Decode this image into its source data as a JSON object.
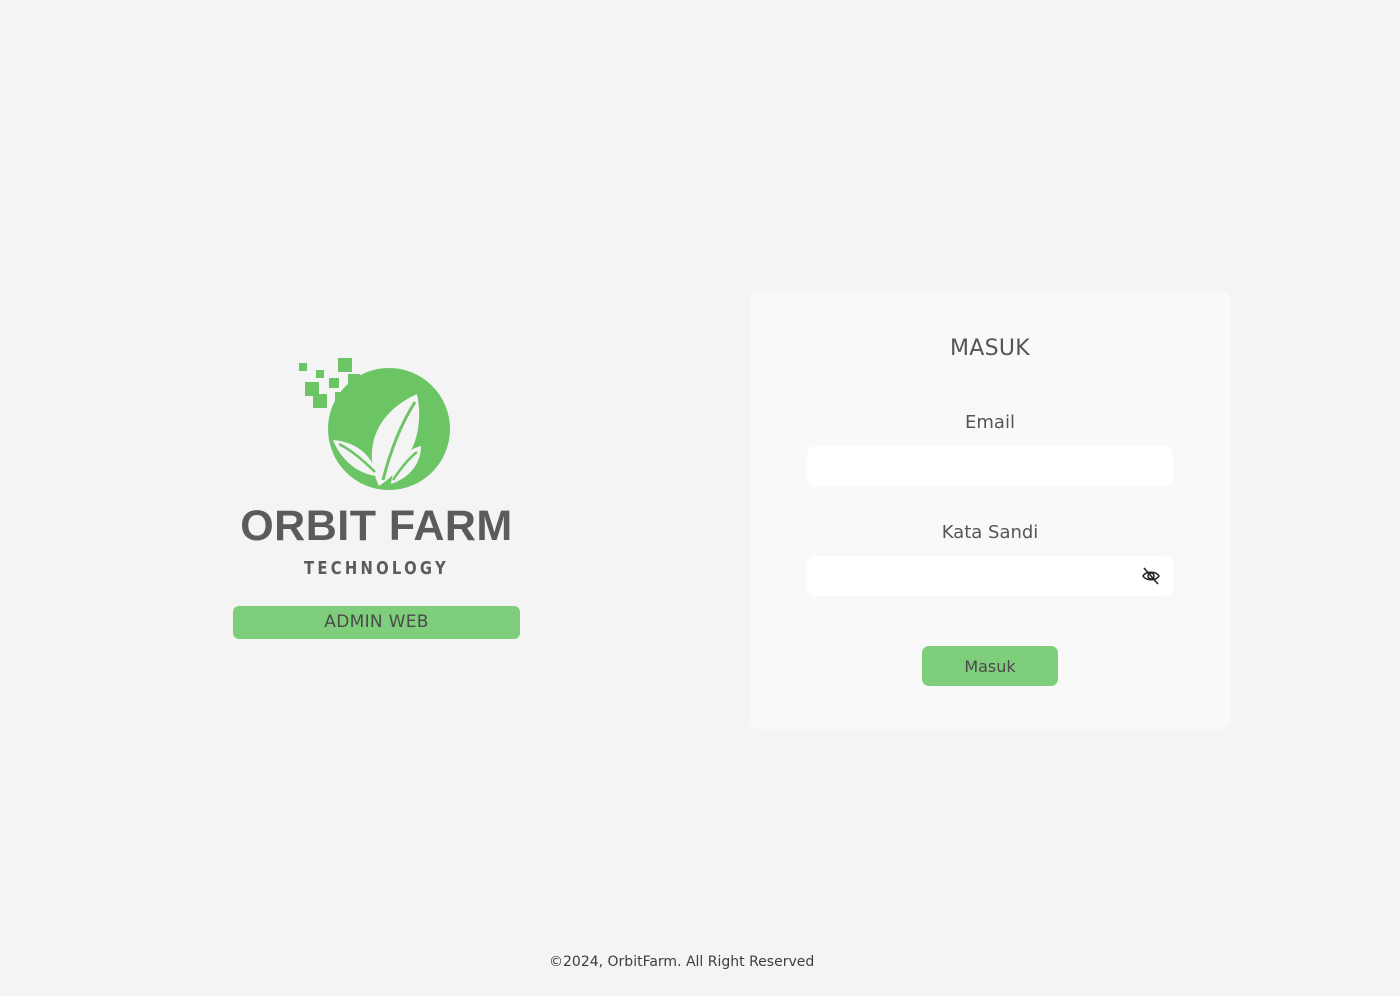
{
  "brand": {
    "name": "ORBIT FARM",
    "tagline": "TECHNOLOGY",
    "badge": "ADMIN WEB",
    "logo_icon": "leaf-globe-pixel-logo",
    "accent_color": "#6cc565"
  },
  "login": {
    "title": "MASUK",
    "email_label": "Email",
    "email_value": "",
    "password_label": "Kata Sandi",
    "password_value": "",
    "password_toggle_icon": "eye-off-icon",
    "submit_label": "Masuk",
    "button_color": "#7fce7b"
  },
  "footer": {
    "copyright": "©2024, OrbitFarm. All Right Reserved"
  }
}
